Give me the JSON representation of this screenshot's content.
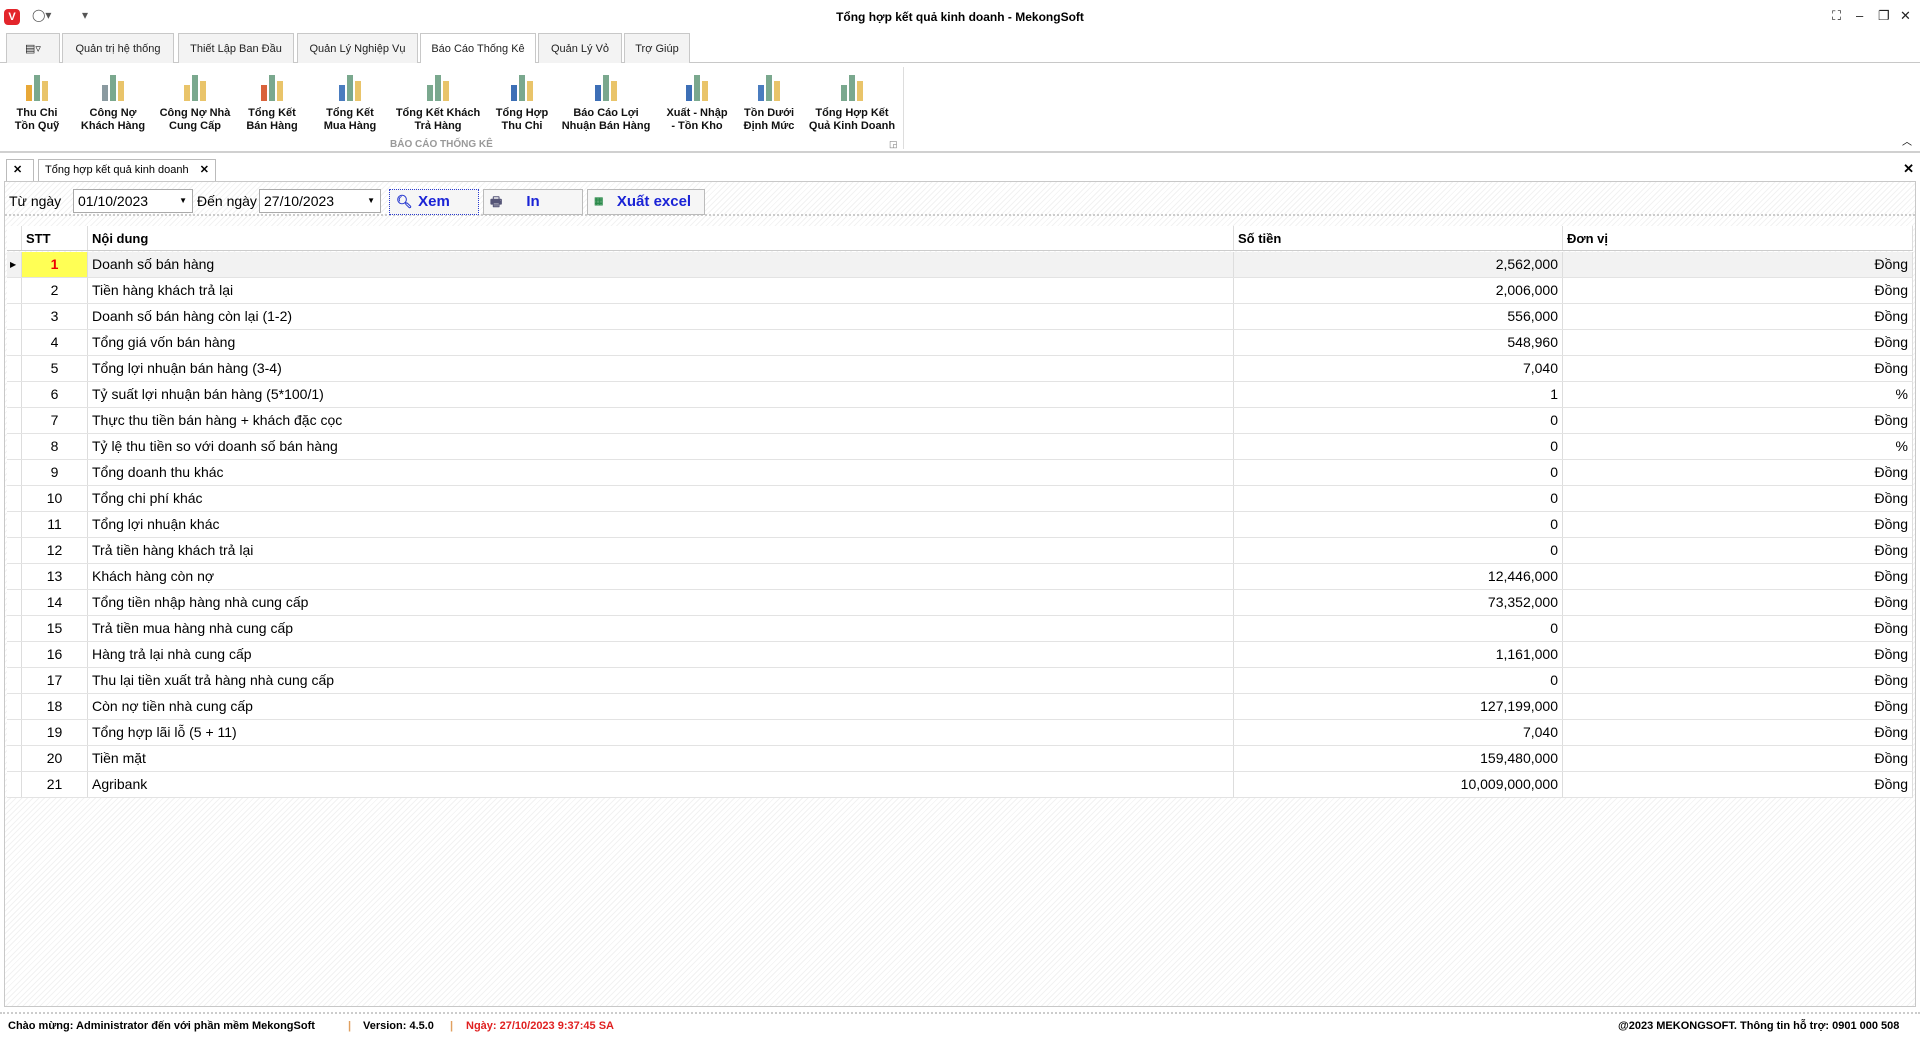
{
  "window": {
    "title": "Tổng hợp kết quả kinh doanh - MekongSoft",
    "logo": "V"
  },
  "menu_tabs": [
    "Quản trị hệ thống",
    "Thiết Lập Ban Đầu",
    "Quản Lý Nghiệp Vụ",
    "Báo Cáo Thống Kê",
    "Quản Lý Vỏ",
    "Trợ Giúp"
  ],
  "ribbon": {
    "group": "BÁO CÁO THỐNG KÊ",
    "buttons": [
      {
        "l1": "Thu Chi",
        "l2": "Tồn Quỹ",
        "color": "#e8a838"
      },
      {
        "l1": "Công Nợ",
        "l2": "Khách Hàng",
        "color": "#8a9aa0"
      },
      {
        "l1": "Công Nợ Nhà",
        "l2": "Cung Cấp",
        "color": "#e9c46a"
      },
      {
        "l1": "Tổng Kết",
        "l2": "Bán Hàng",
        "color": "#d9623b"
      },
      {
        "l1": "Tổng Kết",
        "l2": "Mua Hàng",
        "color": "#4a7cbf"
      },
      {
        "l1": "Tổng Kết Khách",
        "l2": "Trả Hàng",
        "color": "#7aa88e"
      },
      {
        "l1": "Tổng Hợp",
        "l2": "Thu Chi",
        "color": "#3d6fb6"
      },
      {
        "l1": "Báo Cáo Lợi",
        "l2": "Nhuận Bán Hàng",
        "color": "#3d6fb6"
      },
      {
        "l1": "Xuất - Nhập",
        "l2": "- Tồn Kho",
        "color": "#3d6fb6"
      },
      {
        "l1": "Tồn Dưới",
        "l2": "Định Mức",
        "color": "#4a7cbf"
      },
      {
        "l1": "Tổng Hợp Kết",
        "l2": "Quả Kinh Doanh",
        "color": "#7aa88e"
      }
    ]
  },
  "doc_tab": "Tổng hợp kết quả kinh doanh",
  "filter": {
    "from_label": "Từ ngày",
    "from": "01/10/2023",
    "to_label": "Đến ngày",
    "to": "27/10/2023",
    "view": "Xem",
    "print": "In",
    "excel": "Xuất excel"
  },
  "columns": [
    "STT",
    "Nội dung",
    "Số tiền",
    "Đơn vị"
  ],
  "rows": [
    [
      "1",
      "Doanh số bán hàng",
      "2,562,000",
      "Đồng"
    ],
    [
      "2",
      "Tiền hàng khách trả lại",
      "2,006,000",
      "Đồng"
    ],
    [
      "3",
      "Doanh số bán hàng còn lại (1-2)",
      "556,000",
      "Đồng"
    ],
    [
      "4",
      "Tổng giá vốn bán hàng",
      "548,960",
      "Đồng"
    ],
    [
      "5",
      "Tổng lợi nhuận bán hàng (3-4)",
      "7,040",
      "Đồng"
    ],
    [
      "6",
      "Tỷ suất lợi nhuận bán hàng (5*100/1)",
      "1",
      "%"
    ],
    [
      "7",
      "Thực thu tiền bán hàng + khách đặc cọc",
      "0",
      "Đồng"
    ],
    [
      "8",
      "Tỷ lệ thu tiền so với doanh số bán hàng",
      "0",
      "%"
    ],
    [
      "9",
      "Tổng doanh thu khác",
      "0",
      "Đồng"
    ],
    [
      "10",
      "Tổng chi phí khác",
      "0",
      "Đồng"
    ],
    [
      "11",
      "Tổng lợi nhuận khác",
      "0",
      "Đồng"
    ],
    [
      "12",
      "Trả tiền hàng khách trả lại",
      "0",
      "Đồng"
    ],
    [
      "13",
      "Khách hàng còn nợ",
      "12,446,000",
      "Đồng"
    ],
    [
      "14",
      "Tổng tiền nhập hàng nhà cung cấp",
      "73,352,000",
      "Đồng"
    ],
    [
      "15",
      "Trả tiền mua hàng nhà cung cấp",
      "0",
      "Đồng"
    ],
    [
      "16",
      "Hàng trả lại nhà cung cấp",
      "1,161,000",
      "Đồng"
    ],
    [
      "17",
      "Thu lại tiền xuất trả hàng nhà cung cấp",
      "0",
      "Đồng"
    ],
    [
      "18",
      "Còn nợ tiền nhà cung cấp",
      "127,199,000",
      "Đồng"
    ],
    [
      "19",
      "Tổng hợp lãi lỗ  (5 + 11)",
      "7,040",
      "Đồng"
    ],
    [
      "20",
      "Tiền mặt",
      "159,480,000",
      "Đồng"
    ],
    [
      "21",
      "Agribank",
      "10,009,000,000",
      "Đồng"
    ]
  ],
  "status": {
    "welcome": "Chào mừng: Administrator đến với phần mềm MekongSoft",
    "version": "Version: 4.5.0",
    "date": "Ngày: 27/10/2023 9:37:45 SA",
    "copyright": "@2023 MEKONGSOFT. Thông tin hỗ trợ: 0901 000 508"
  }
}
